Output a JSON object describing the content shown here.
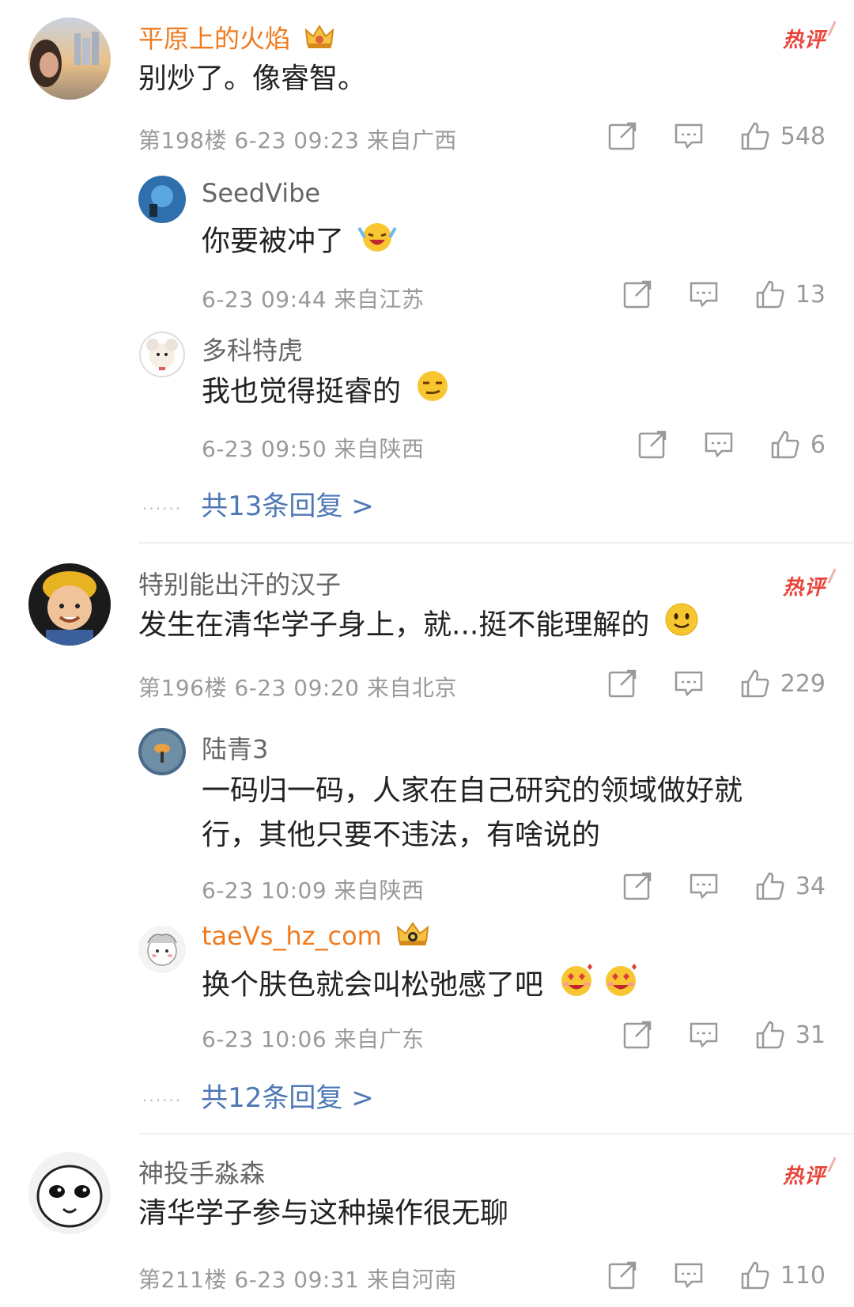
{
  "hot_label": "热评",
  "icons": {
    "share": "share-icon",
    "comment": "comment-icon",
    "like": "thumbs-up-icon",
    "crown": "crown-badge-icon"
  },
  "colors": {
    "orange_name": "#f07b1e",
    "link_blue": "#4e78b5",
    "hot_red": "#e8443a",
    "meta_gray": "#9a9a9a"
  },
  "comments": [
    {
      "username": "平原上的火焰",
      "text": "别炒了。像睿智。",
      "meta": "第198楼 6-23 09:23 来自广西",
      "likes": "548",
      "replies": [
        {
          "username": "SeedVibe",
          "text": "你要被冲了",
          "meta": "6-23 09:44 来自江苏",
          "likes": "13"
        },
        {
          "username": "多科特虎",
          "text": "我也觉得挺睿的",
          "meta": "6-23 09:50 来自陕西",
          "likes": "6"
        }
      ],
      "more": "共13条回复 >"
    },
    {
      "username": "特别能出汗的汉子",
      "text": "发生在清华学子身上，就...挺不能理解的",
      "meta": "第196楼 6-23 09:20 来自北京",
      "likes": "229",
      "replies": [
        {
          "username": "陆青3",
          "text_line1": "一码归一码，人家在自己研究的领域做好就",
          "text_line2": "行，其他只要不违法，有啥说的",
          "meta": "6-23 10:09 来自陕西",
          "likes": "34"
        },
        {
          "username": "taeVs_hz_com",
          "text": "换个肤色就会叫松弛感了吧",
          "meta": "6-23 10:06 来自广东",
          "likes": "31"
        }
      ],
      "more": "共12条回复 >"
    },
    {
      "username": "神投手淼森",
      "text": "清华学子参与这种操作很无聊",
      "meta": "第211楼 6-23 09:31 来自河南",
      "likes": "110"
    }
  ]
}
